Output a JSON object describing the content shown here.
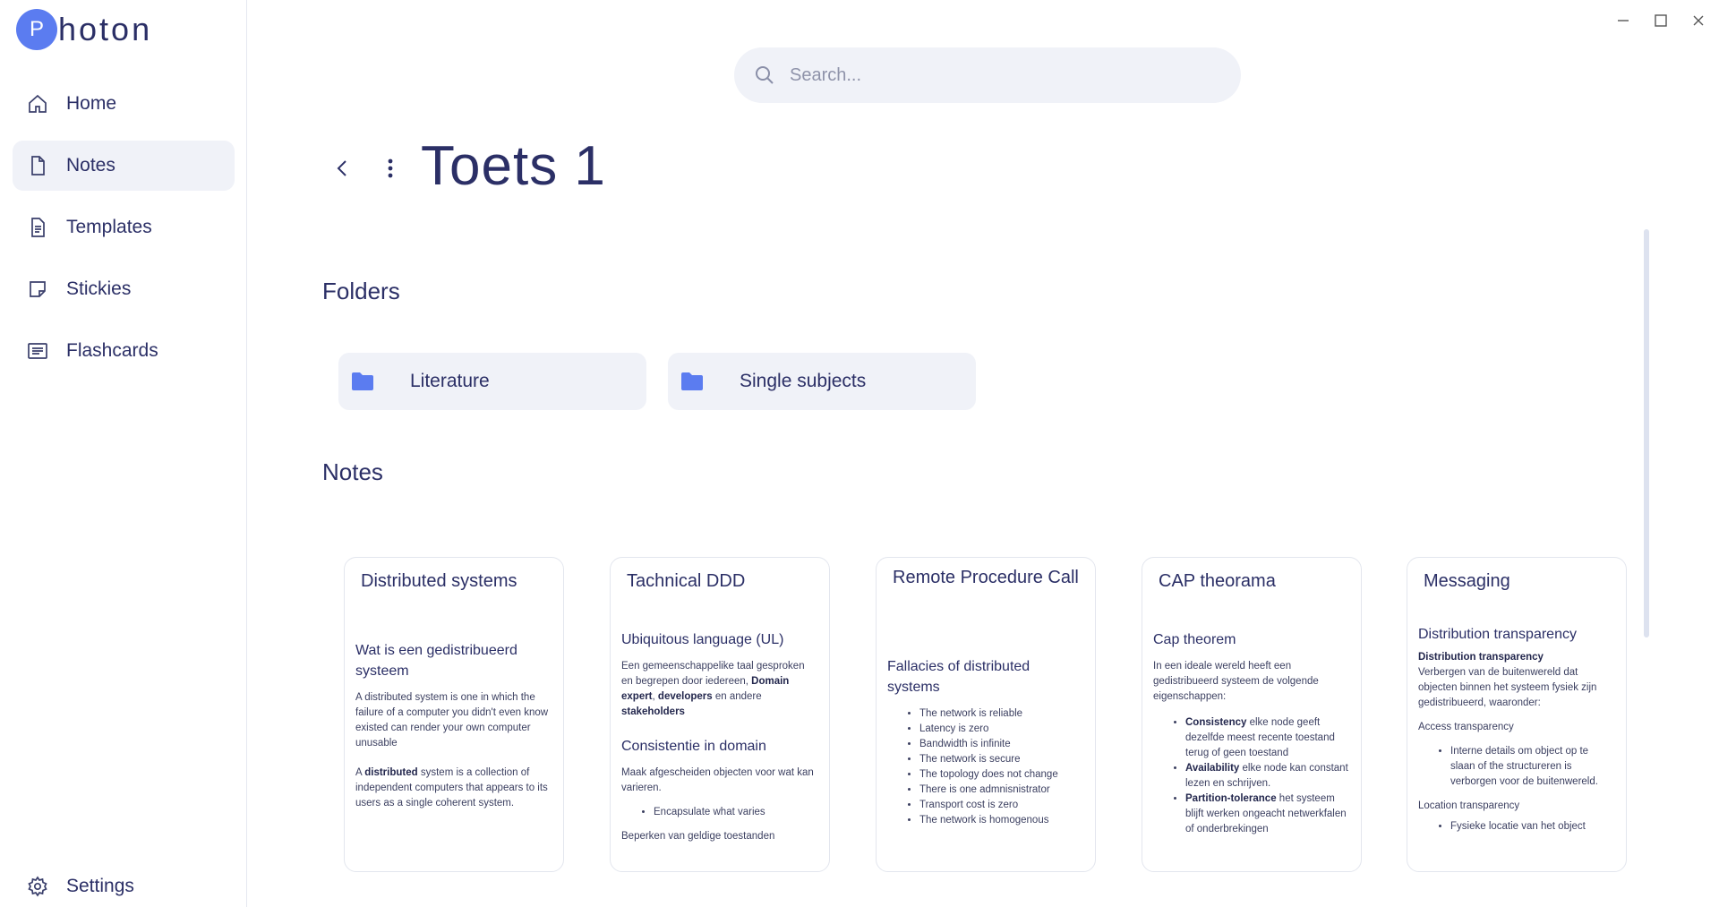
{
  "app": {
    "logo_letter": "P",
    "logo_text": "hoton"
  },
  "sidebar": {
    "items": [
      {
        "label": "Home",
        "icon": "home-icon"
      },
      {
        "label": "Notes",
        "icon": "note-icon",
        "active": true
      },
      {
        "label": "Templates",
        "icon": "template-icon"
      },
      {
        "label": "Stickies",
        "icon": "sticky-icon"
      },
      {
        "label": "Flashcards",
        "icon": "flashcard-icon"
      }
    ],
    "settings_label": "Settings"
  },
  "search": {
    "placeholder": "Search..."
  },
  "page": {
    "title": "Toets 1"
  },
  "folders": {
    "heading": "Folders",
    "items": [
      {
        "label": "Literature"
      },
      {
        "label": "Single subjects"
      }
    ]
  },
  "notes": {
    "heading": "Notes",
    "items": [
      {
        "title": "Distributed systems",
        "h1": "Wat is een gedistribueerd systeem",
        "p1": "A distributed system is one in which the failure of a computer you didn't even know existed can render your own computer unusable",
        "p2_pre": "A ",
        "p2_bold": "distributed",
        "p2_post": " system is a collection of independent computers that appears to its users as a single coherent system."
      },
      {
        "title": "Tachnical DDD",
        "h1": "Ubiquitous language (UL)",
        "p1_pre": "Een gemeenschappelike taal gesproken en begrepen door iedereen, ",
        "p1_b1": "Domain expert",
        "p1_sep": ", ",
        "p1_b2": "developers",
        "p1_mid": " en andere ",
        "p1_b3": "stakeholders",
        "h2": "Consistentie in domain",
        "p2": "Maak afgescheiden objecten voor wat kan varieren.",
        "li1": "Encapsulate what varies",
        "p3": "Beperken van geldige toestanden"
      },
      {
        "title": "Remote Procedure Call",
        "h1": "Fallacies of distributed systems",
        "list": [
          "The network is reliable",
          "Latency is zero",
          "Bandwidth is infinite",
          "The network is secure",
          "The topology does not change",
          "There is one admnisnistrator",
          "Transport cost is zero",
          "The network is homogenous"
        ]
      },
      {
        "title": "CAP theorama",
        "h1": "Cap theorem",
        "p1": "In een ideale wereld heeft een gedistribueerd systeem de volgende eigenschappen:",
        "li1_b": "Consistency",
        "li1": " elke node geeft dezelfde meest recente toestand terug of geen toestand",
        "li2_b": "Availability",
        "li2": " elke node kan constant lezen en schrijven.",
        "li3_b": "Partition-tolerance",
        "li3": " het systeem blijft werken ongeacht netwerkfalen of onderbrekingen"
      },
      {
        "title": "Messaging",
        "h1": "Distribution transparency",
        "p1_b": "Distribution transparency",
        "p1": "Verbergen van de buitenwereld dat objecten binnen het systeem fysiek zijn gedistribueerd, waaronder:",
        "p2": "Access transparency",
        "li1": "Interne details om object op te slaan of the structureren is verborgen voor de buitenwereld.",
        "p3": "Location transparency",
        "li2": "Fysieke locatie van het object"
      }
    ]
  }
}
